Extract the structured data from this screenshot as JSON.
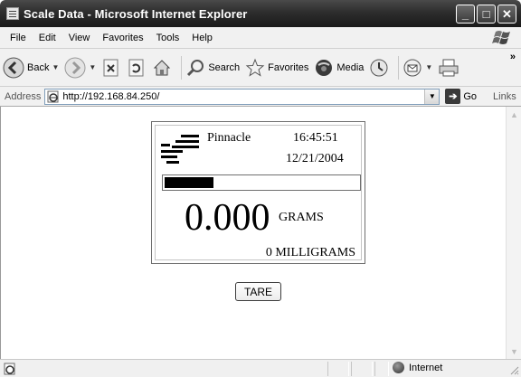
{
  "window": {
    "title": "Scale Data - Microsoft Internet Explorer",
    "minimize_glyph": "_",
    "maximize_glyph": "□",
    "close_glyph": "✕"
  },
  "menu": {
    "items": [
      "File",
      "Edit",
      "View",
      "Favorites",
      "Tools",
      "Help"
    ]
  },
  "toolbar": {
    "back_label": "Back",
    "search_label": "Search",
    "favorites_label": "Favorites",
    "media_label": "Media",
    "more_glyph": "»"
  },
  "address": {
    "label": "Address",
    "url": "http://192.168.84.250/",
    "go_label": "Go",
    "links_label": "Links"
  },
  "scale": {
    "brand": "Pinnacle",
    "time": "16:45:51",
    "date": "12/21/2004",
    "level_fraction": 0.25,
    "weight": "0.000",
    "unit": "GRAMS",
    "sub_weight": "0 MILLIGRAMS",
    "tare_label": "TARE"
  },
  "status": {
    "zone_label": "Internet"
  },
  "icons": {
    "app": "ie-page-icon",
    "back": "back-arrow-icon",
    "forward": "forward-arrow-icon",
    "stop": "stop-icon",
    "refresh": "refresh-icon",
    "home": "home-icon",
    "search": "search-icon",
    "favorites": "favorites-star-icon",
    "media": "media-icon",
    "history": "history-icon",
    "mail": "mail-icon",
    "print": "print-icon"
  }
}
